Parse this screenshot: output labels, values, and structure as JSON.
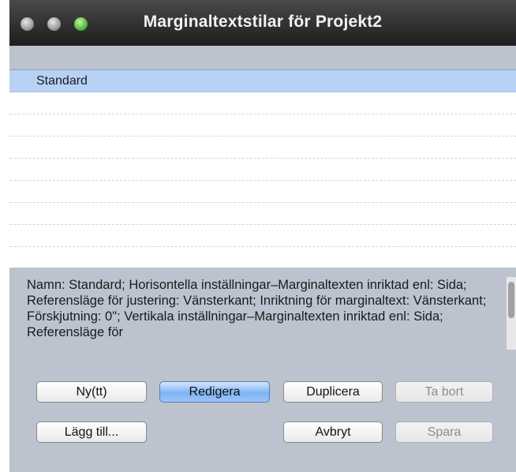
{
  "window": {
    "title": "Marginaltextstilar för Projekt2"
  },
  "styles_list": {
    "items": [
      "Standard"
    ],
    "selected_index": 0
  },
  "description": "Namn: Standard; Horisontella inställningar–Marginaltexten inriktad enl: Sida; Referensläge för justering: Vänsterkant; Inriktning för marginaltext: Vänsterkant; Förskjutning: 0\"; Vertikala inställningar–Marginaltexten inriktad enl: Sida; Referensläge för",
  "buttons": {
    "new": "Ny(tt)",
    "edit": "Redigera",
    "duplicate": "Duplicera",
    "delete": "Ta bort",
    "append": "Lägg till...",
    "cancel": "Avbryt",
    "save": "Spara"
  }
}
